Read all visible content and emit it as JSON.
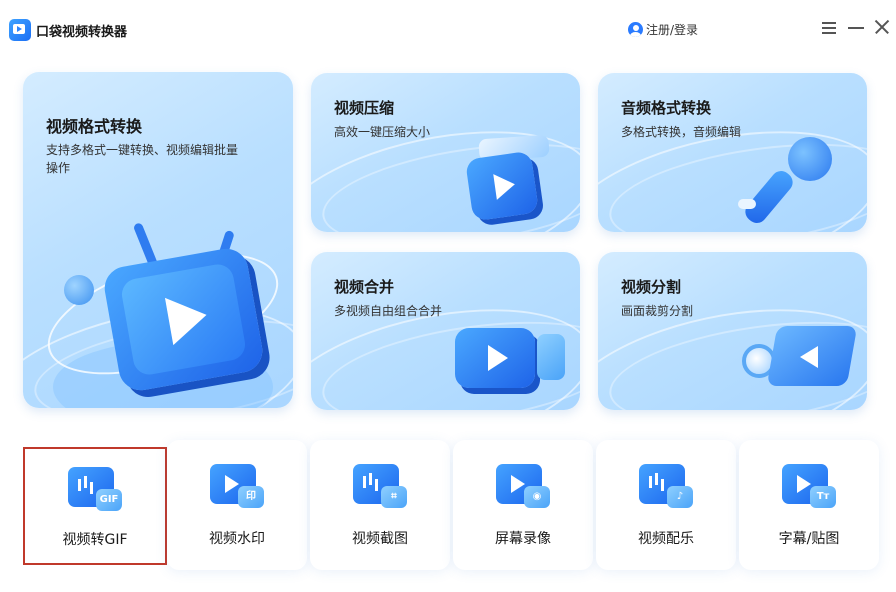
{
  "app": {
    "title": "口袋视频转换器",
    "login": "注册/登录"
  },
  "icons": {
    "logo": "app-logo-icon",
    "user": "user-icon",
    "menu": "hamburger-menu-icon",
    "minimize": "minimize-icon",
    "close": "close-icon"
  },
  "features": {
    "format_convert": {
      "title": "视频格式转换",
      "desc": "支持多格式一键转换、视频编辑批量操作"
    },
    "compress": {
      "title": "视频压缩",
      "desc": "高效一键压缩大小"
    },
    "audio_convert": {
      "title": "音频格式转换",
      "desc": "多格式转换，音频编辑"
    },
    "merge": {
      "title": "视频合并",
      "desc": "多视频自由组合合并"
    },
    "split": {
      "title": "视频分割",
      "desc": "画面裁剪分割"
    }
  },
  "tools": [
    {
      "label": "视频转GIF",
      "badge": "GIF",
      "icon": "gif-icon",
      "selected": true
    },
    {
      "label": "视频水印",
      "badge": "印",
      "icon": "watermark-icon",
      "selected": false
    },
    {
      "label": "视频截图",
      "badge": "⌗",
      "icon": "crop-icon",
      "selected": false
    },
    {
      "label": "屏幕录像",
      "badge": "◉",
      "icon": "webcam-icon",
      "selected": false
    },
    {
      "label": "视频配乐",
      "badge": "♪",
      "icon": "music-note-icon",
      "selected": false
    },
    {
      "label": "字幕/贴图",
      "badge": "Tт",
      "icon": "text-icon",
      "selected": false
    }
  ],
  "colors": {
    "accent": "#1e63e8",
    "card_bg": "#b9dfff",
    "selection": "#c0392b"
  }
}
